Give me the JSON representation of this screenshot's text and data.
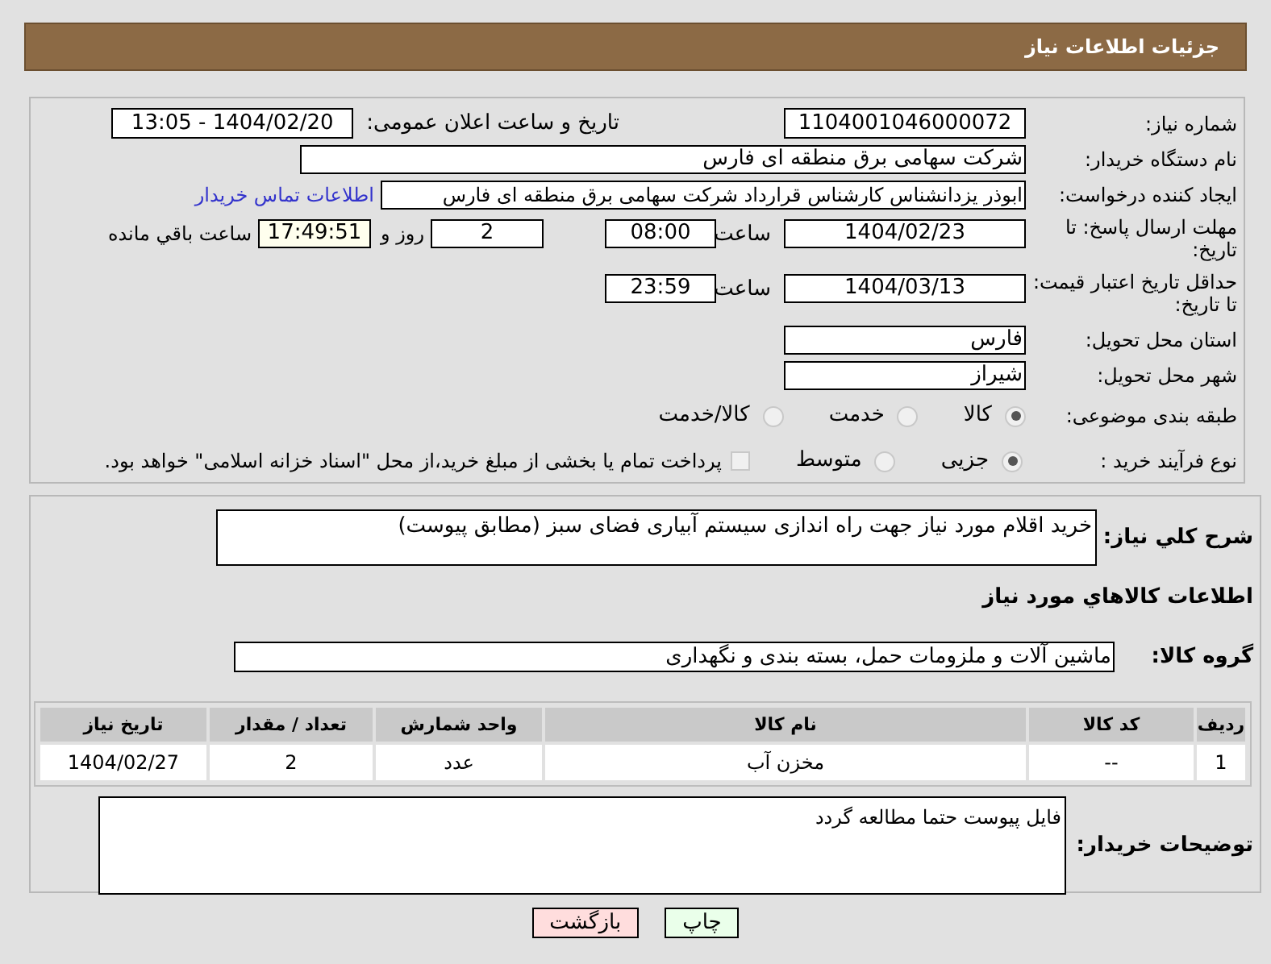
{
  "header": {
    "title": "جزئیات اطلاعات نیاز"
  },
  "need_number": {
    "label": "شماره نیاز:",
    "value": "1104001046000072"
  },
  "announce": {
    "label": "تاریخ و ساعت اعلان عمومی:",
    "value": "1404/02/20 - 13:05"
  },
  "buyer_org": {
    "label": "نام دستگاه خریدار:",
    "value": "شرکت سهامی برق منطقه ای فارس"
  },
  "requester": {
    "label": "ایجاد کننده درخواست:",
    "value": "ابوذر  یزدانشناس کارشناس قرارداد شرکت سهامی برق منطقه ای فارس",
    "link": "اطلاعات تماس خریدار"
  },
  "reply_deadline": {
    "label": "مهلت ارسال پاسخ: تا تاریخ:",
    "date": "1404/02/23",
    "time_label": "ساعت",
    "time": "08:00",
    "days": "2",
    "days_label": "روز و",
    "remaining": "17:49:51",
    "remaining_label": "ساعت باقي مانده"
  },
  "price_validity": {
    "label": "حداقل تاریخ اعتبار قیمت: تا تاریخ:",
    "date": "1404/03/13",
    "time_label": "ساعت",
    "time": "23:59"
  },
  "province": {
    "label": "استان محل تحویل:",
    "value": "فارس"
  },
  "city": {
    "label": "شهر محل تحویل:",
    "value": "شیراز"
  },
  "category": {
    "label": "طبقه بندی موضوعی:",
    "options": [
      {
        "label": "کالا",
        "selected": true
      },
      {
        "label": "خدمت",
        "selected": false
      },
      {
        "label": "کالا/خدمت",
        "selected": false
      }
    ]
  },
  "process": {
    "label": "نوع فرآیند خرید :",
    "options": [
      {
        "label": "جزیی",
        "selected": true
      },
      {
        "label": "متوسط",
        "selected": false
      }
    ],
    "payment": {
      "checked": false,
      "text": "پرداخت تمام یا بخشی از مبلغ خرید،از محل \"اسناد خزانه اسلامی\" خواهد بود."
    }
  },
  "description": {
    "label": "شرح کلي نياز:",
    "value": "خرید اقلام مورد نیاز جهت راه اندازی سیستم آبیاری فضای سبز (مطابق پیوست)"
  },
  "goods_heading": "اطلاعات کالاهاي مورد نياز",
  "goods_group": {
    "label": "گروه کالا:",
    "value": "ماشین آلات و ملزومات حمل، بسته بندی و نگهداری"
  },
  "table": {
    "columns": [
      "ردیف",
      "کد کالا",
      "نام کالا",
      "واحد شمارش",
      "تعداد / مقدار",
      "تاریخ نیاز"
    ],
    "rows": [
      [
        "1",
        "--",
        "مخزن آب",
        "عدد",
        "2",
        "1404/02/27"
      ]
    ]
  },
  "buyer_notes": {
    "label": "توضیحات خریدار:",
    "value": "فایل پیوست حتما مطالعه گردد"
  },
  "buttons": [
    {
      "label": "چاپ",
      "kind": "print"
    },
    {
      "label": "بازگشت",
      "kind": "back"
    }
  ]
}
